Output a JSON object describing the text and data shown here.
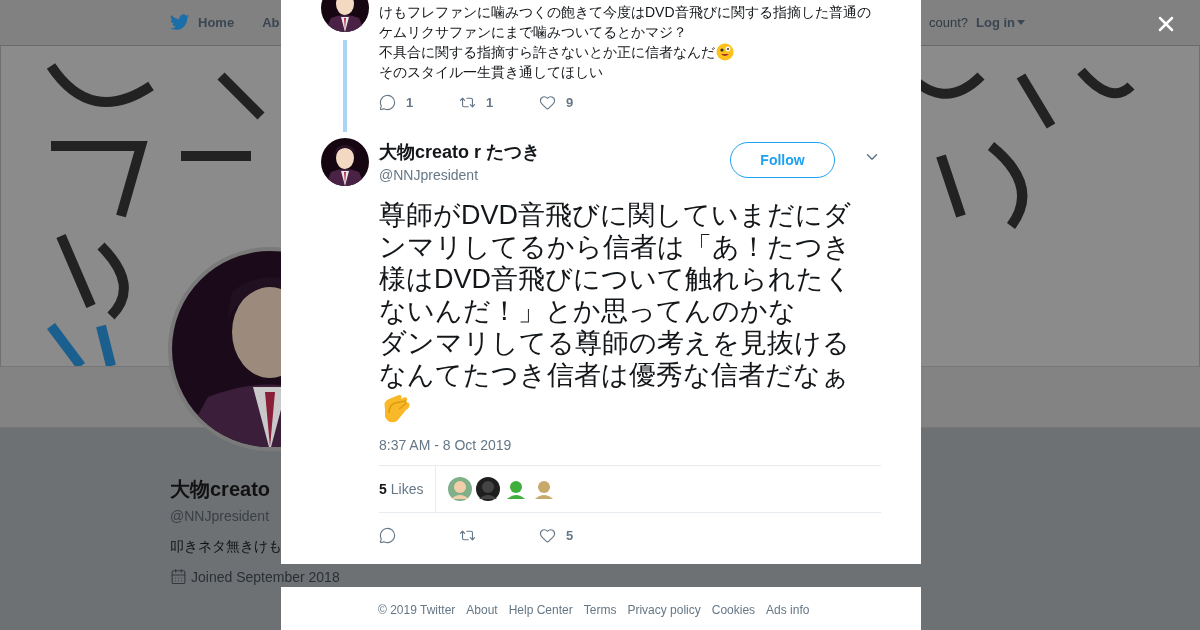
{
  "nav": {
    "home": "Home",
    "about": "Ab",
    "account_prompt": "count?",
    "login": "Log in"
  },
  "profile": {
    "name": "大物creato",
    "handle": "@NNJpresident",
    "bio": "叩きネタ無きけも",
    "joined": "Joined September 2018"
  },
  "modal": {
    "previous_tweet": {
      "paragraph": "けもフレファンに噛みつくの飽きて今度はDVD音飛びに関する指摘した普通のケムリクサファンにまで噛みついてるとかマジ？",
      "line_before_emoji": "不具合に関する指摘すら許さないとか正に信者なんだ",
      "last_line": "そのスタイル一生貫き通してほしい",
      "actions": [
        {
          "kind": "reply",
          "count": "1"
        },
        {
          "kind": "retweet",
          "count": "1"
        },
        {
          "kind": "like",
          "count": "9"
        }
      ]
    },
    "tweet": {
      "name": "大物creato r たつき",
      "handle": "@NNJpresident",
      "follow_label": "Follow",
      "paragraphs": [
        "尊師がDVD音飛びに関していまだにダンマリしてるから信者は「あ！たつき様はDVD音飛びについて触れられたくないんだ！」とか思ってんのかな",
        "ダンマリしてる尊師の考えを見抜けるなんてたつき信者は優秀な信者だなぁ"
      ],
      "timestamp": "8:37 AM - 8 Oct 2019",
      "likes_count": "5",
      "likes_label": "Likes",
      "actions": [
        {
          "kind": "reply"
        },
        {
          "kind": "retweet"
        },
        {
          "kind": "like",
          "count": "5"
        }
      ]
    }
  },
  "footer": {
    "links": [
      "© 2019 Twitter",
      "About",
      "Help Center",
      "Terms",
      "Privacy policy",
      "Cookies",
      "Ads info"
    ]
  }
}
